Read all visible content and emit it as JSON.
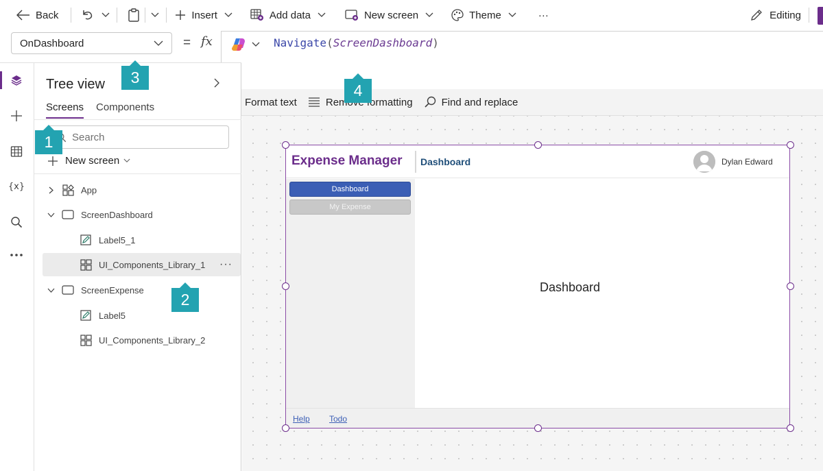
{
  "toolbar": {
    "back": "Back",
    "insert": "Insert",
    "add_data": "Add data",
    "new_screen": "New screen",
    "theme": "Theme",
    "more": "···",
    "editing": "Editing"
  },
  "formula_bar": {
    "property": "OnDashboard",
    "equals": "=",
    "fx": "fx",
    "function": "Navigate",
    "open_paren": "(",
    "argument": "ScreenDashboard",
    "close_paren": ")"
  },
  "format_bar": {
    "format_text": "Format text",
    "remove_formatting": "Remove formatting",
    "find_replace": "Find and replace"
  },
  "rail": {
    "icons": [
      "layers-icon",
      "plus-icon",
      "table-icon",
      "variables-icon",
      "search-icon",
      "more-icon"
    ],
    "variables_glyph": "{x}"
  },
  "tree": {
    "title": "Tree view",
    "tabs": [
      "Screens",
      "Components"
    ],
    "search_placeholder": "Search",
    "new_screen": "New screen",
    "nodes": [
      {
        "label": "App"
      },
      {
        "label": "ScreenDashboard"
      },
      {
        "label": "Label5_1"
      },
      {
        "label": "UI_Components_Library_1"
      },
      {
        "label": "ScreenExpense"
      },
      {
        "label": "Label5"
      },
      {
        "label": "UI_Components_Library_2"
      }
    ],
    "more": "···"
  },
  "app_preview": {
    "title": "Expense Manager",
    "page": "Dashboard",
    "user": "Dylan Edward",
    "nav": [
      "Dashboard",
      "My Expense"
    ],
    "main_text": "Dashboard",
    "footer_links": [
      "Help",
      "Todo"
    ]
  },
  "callouts": [
    "1",
    "2",
    "3",
    "4"
  ],
  "colors": {
    "accent": "#6b2d8b",
    "callout": "#23a3b1",
    "nav_active": "#3b5eb5"
  }
}
